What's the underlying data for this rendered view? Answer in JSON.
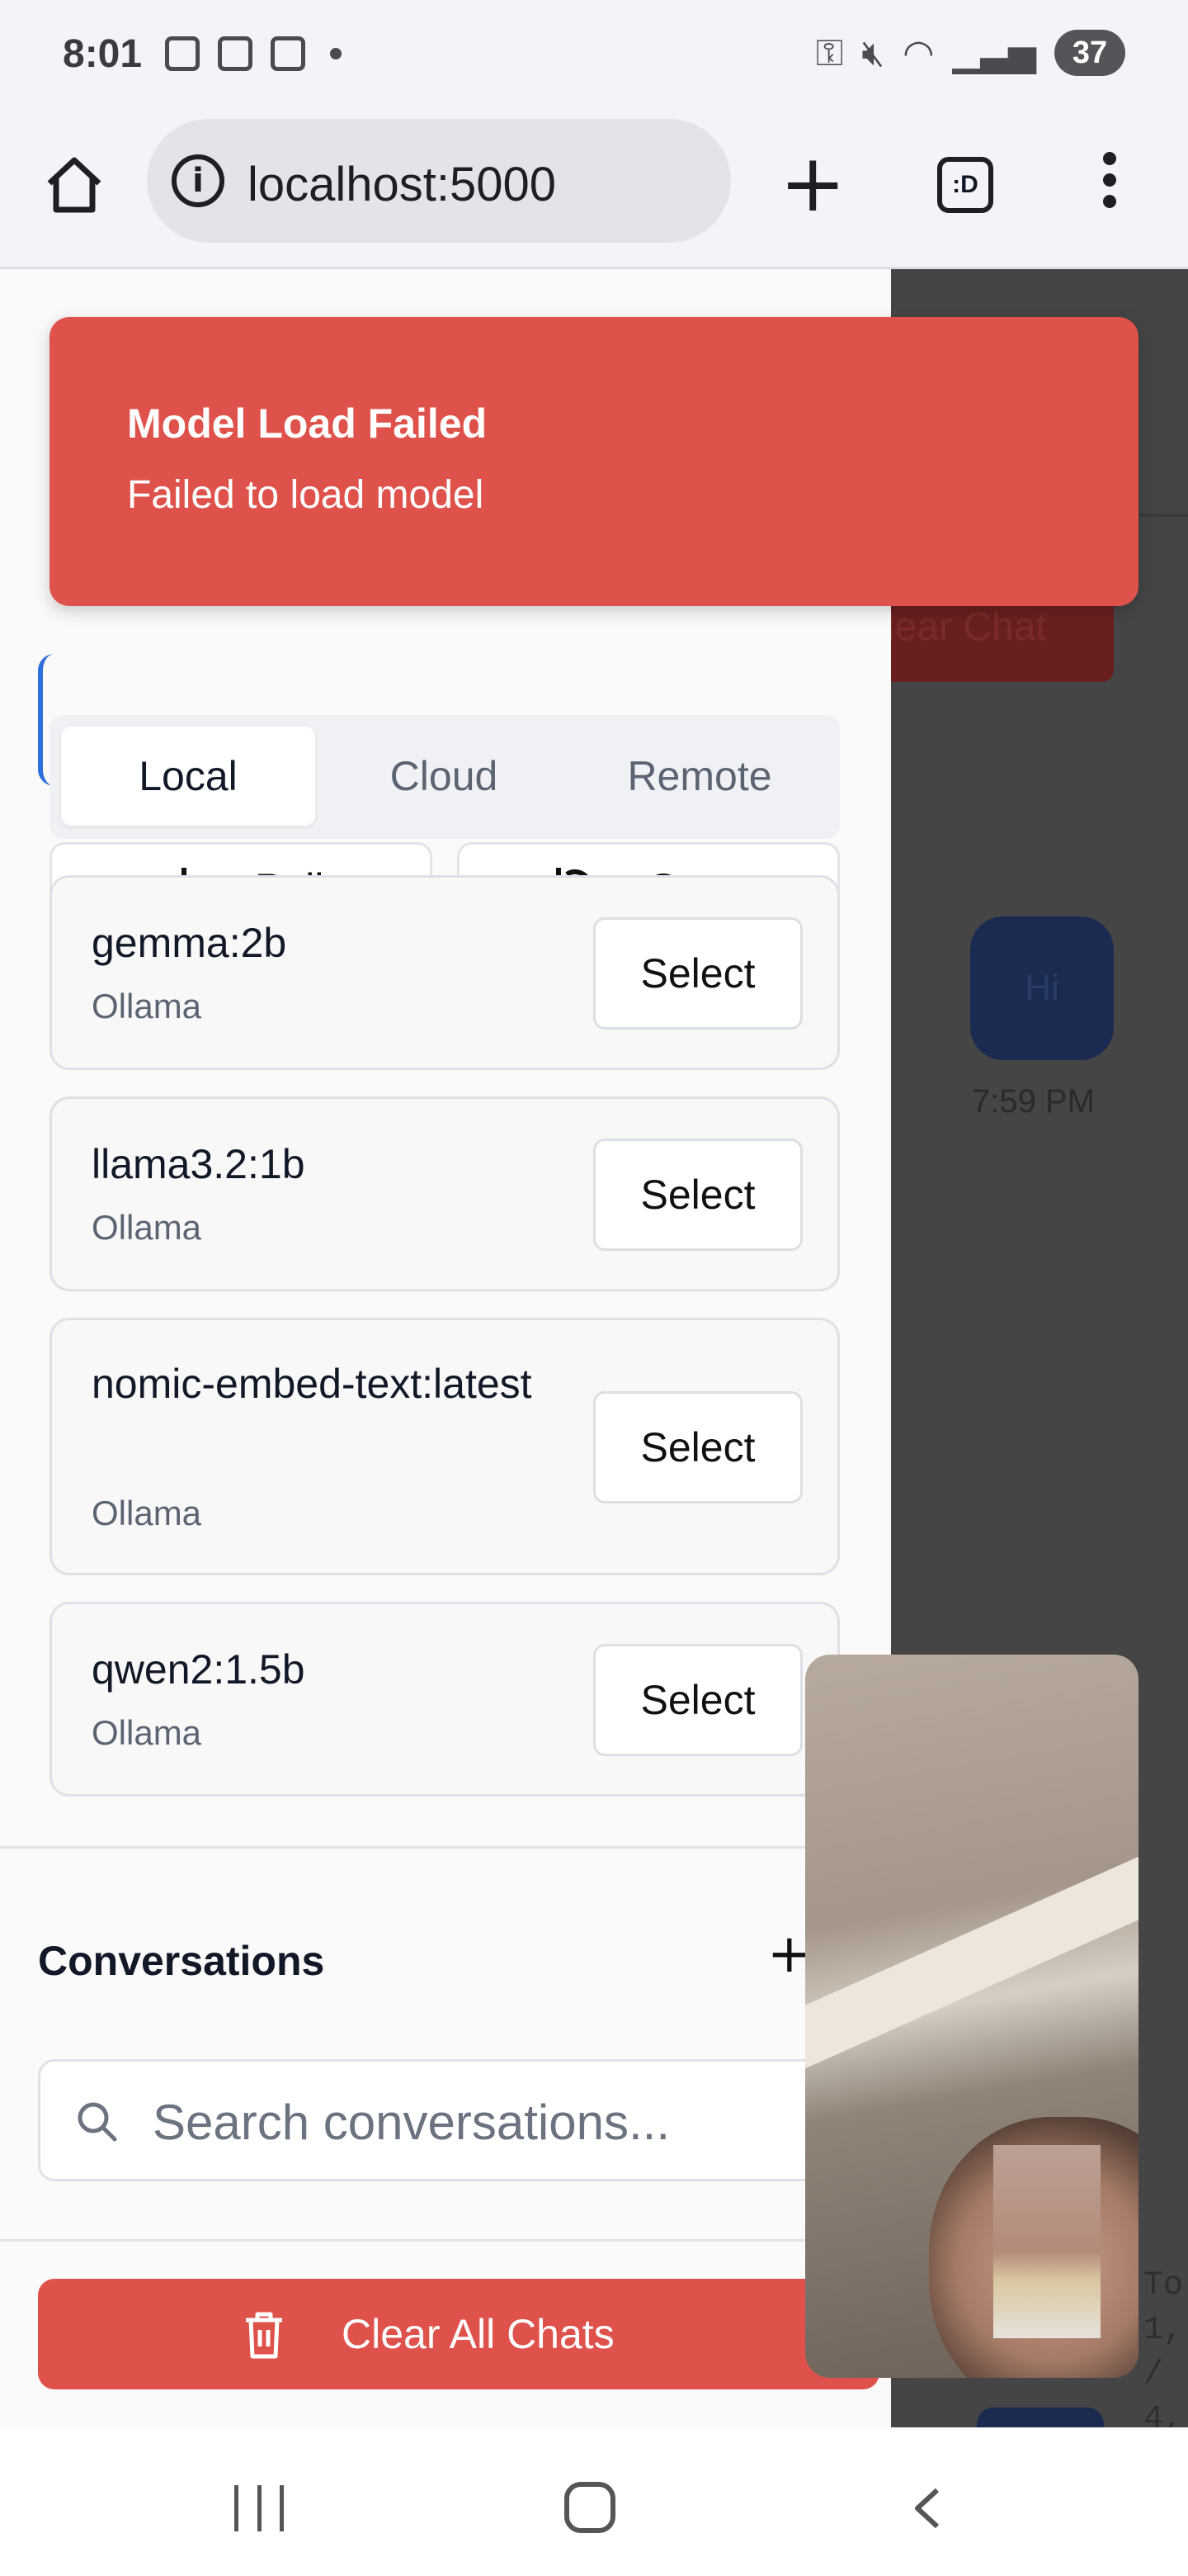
{
  "status_bar": {
    "time": "8:01",
    "battery": "37",
    "left_icons": [
      "video-call-icon",
      "screenshot-icon",
      "calendar-icon",
      "dot-icon"
    ],
    "right_icons": [
      "key-icon",
      "mute-icon",
      "wifi-icon",
      "signal-icon",
      "battery-icon"
    ]
  },
  "browser": {
    "url": "localhost:5000",
    "tabs_label": ":D"
  },
  "toast": {
    "title": "Model Load Failed",
    "message": "Failed to load model",
    "color": "#df524b"
  },
  "actions": {
    "pull": "Pull",
    "sync": "Sync"
  },
  "tabs": {
    "items": [
      "Local",
      "Cloud",
      "Remote"
    ],
    "active": "Local"
  },
  "models": [
    {
      "name": "gemma:2b",
      "provider": "Ollama",
      "action": "Select"
    },
    {
      "name": "llama3.2:1b",
      "provider": "Ollama",
      "action": "Select"
    },
    {
      "name": "nomic-embed-text:latest",
      "provider": "Ollama",
      "action": "Select"
    },
    {
      "name": "qwen2:1.5b",
      "provider": "Ollama",
      "action": "Select"
    }
  ],
  "conversations": {
    "title": "Conversations",
    "add": "+",
    "search_placeholder": "Search conversations..."
  },
  "clear_all": "Clear All Chats",
  "background": {
    "clear_chat": "lear Chat",
    "message": "Hi",
    "time": "7:59 PM",
    "mono_text": "To\n1,\n/\n4,"
  }
}
